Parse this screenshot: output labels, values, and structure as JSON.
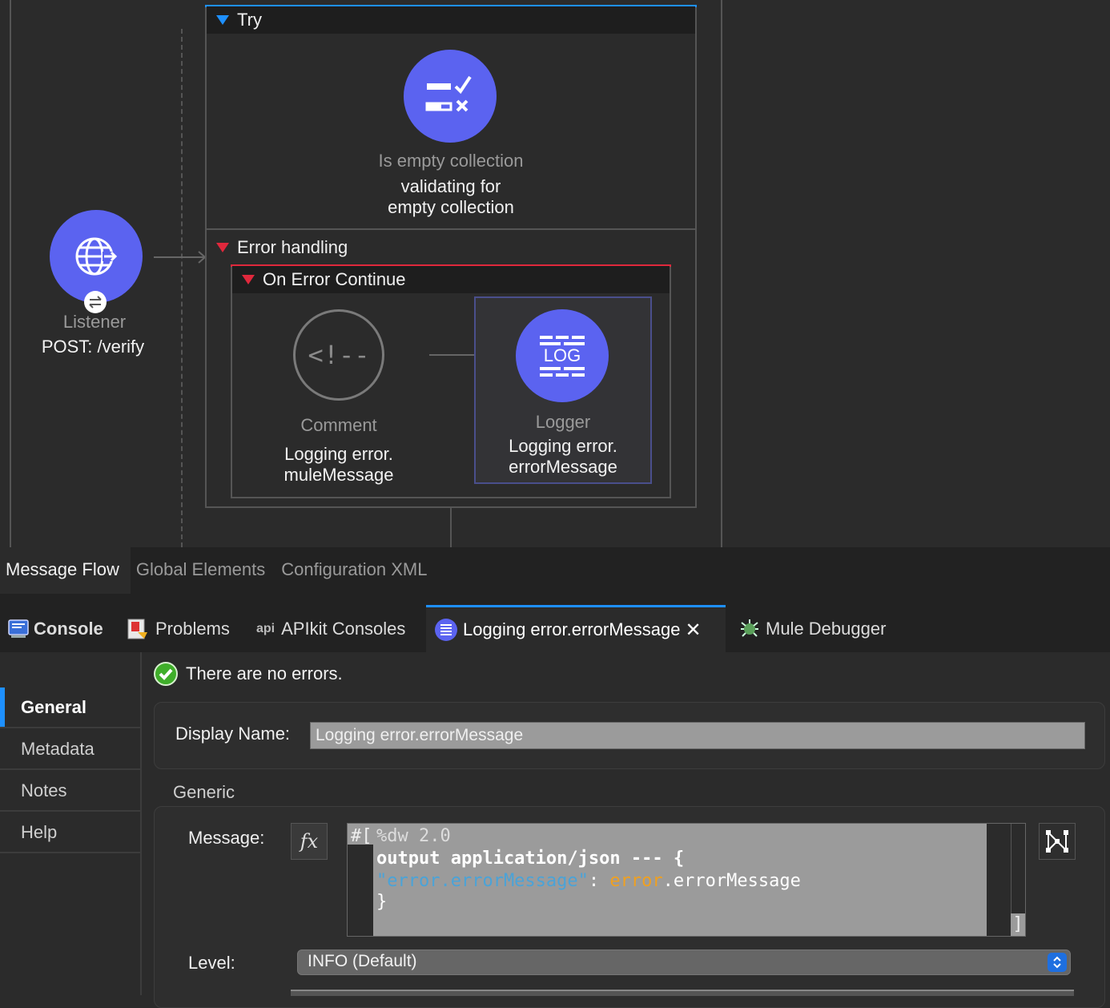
{
  "flow": {
    "listener": {
      "type": "Listener",
      "name": "POST: /verify",
      "icon": "globe-arrow-icon",
      "badge_icon": "exchange-arrows-icon"
    },
    "try_scope": {
      "title": "Try",
      "validator": {
        "type": "Is empty collection",
        "name_line1": "validating for",
        "name_line2": "empty collection",
        "icon": "validation-check-cross-icon"
      }
    },
    "error_handling": {
      "title": "Error handling",
      "on_error": {
        "title": "On Error Continue",
        "comment": {
          "type": "Comment",
          "name_line1": "Logging error.",
          "name_line2": "muleMessage",
          "icon_text": "<!--"
        },
        "logger": {
          "type": "Logger",
          "name_line1": "Logging error.",
          "name_line2": "errorMessage",
          "icon_text": "LOG"
        }
      }
    }
  },
  "editor_tabs": [
    {
      "label": "Message Flow",
      "active": true
    },
    {
      "label": "Global Elements",
      "active": false
    },
    {
      "label": "Configuration XML",
      "active": false
    }
  ],
  "view_tabs": {
    "console": {
      "label": "Console",
      "icon": "console-icon"
    },
    "problems": {
      "label": "Problems",
      "icon": "problems-icon"
    },
    "apikit": {
      "label": "APIkit Consoles",
      "icon_text": "api"
    },
    "logger_tab": {
      "label": "Logging error.errorMessage",
      "icon": "logger-tab-icon",
      "close": "✕"
    },
    "debugger": {
      "label": "Mule Debugger",
      "icon": "bug-icon"
    }
  },
  "properties": {
    "status": "There are no errors.",
    "sidebar": [
      "General",
      "Metadata",
      "Notes",
      "Help"
    ],
    "display_name_label": "Display Name:",
    "display_name_value": "Logging error.errorMessage",
    "generic_label": "Generic",
    "message_label": "Message:",
    "fx_label": "fx",
    "code": {
      "prefix": "#[",
      "line1": "%dw 2.0",
      "line2": "output application/json --- {",
      "key": "\"error.errorMessage\"",
      "colon": ": ",
      "var": "error",
      "rest": ".errorMessage",
      "line4": "}",
      "suffix": "]"
    },
    "level_label": "Level:",
    "level_value": "INFO (Default)"
  },
  "colors": {
    "accent": "#1e90ff",
    "node": "#5b63f0",
    "error": "#e0283c",
    "code_key": "#4aa3d8",
    "code_var": "#f0a020"
  }
}
